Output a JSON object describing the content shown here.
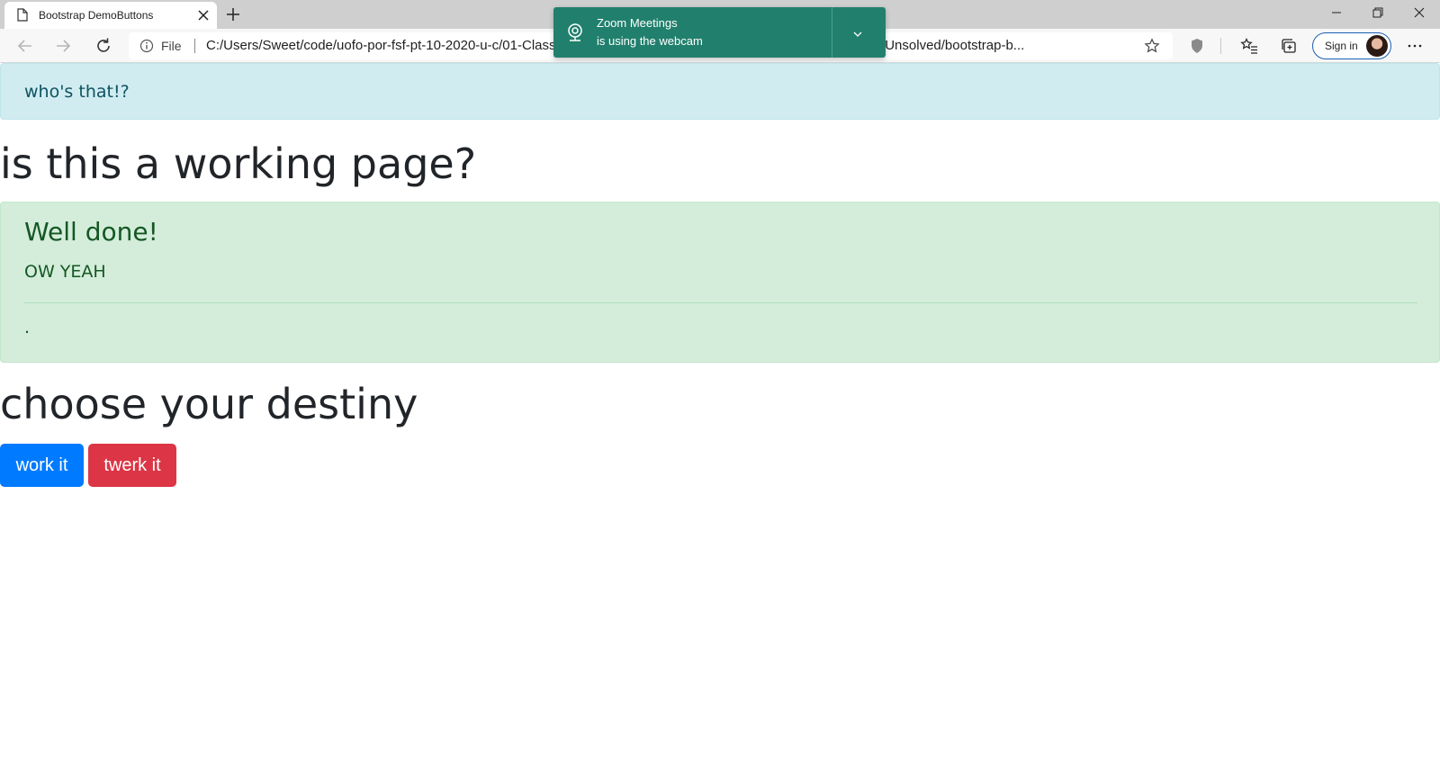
{
  "browser": {
    "tab_title": "Bootstrap DemoButtons",
    "address_scheme": "File",
    "url": "C:/Users/Sweet/code/uofo-por-fsf-pt-10-2020-u-c/01-Class-Content/04-Bootstrap/01-Activities/11-BootstrapDemo/Unsolved/bootstrap-b...",
    "sign_in_label": "Sign in"
  },
  "notification": {
    "title": "Zoom Meetings",
    "subtitle": "is using the webcam"
  },
  "page": {
    "info_alert": "who's that!?",
    "heading_1": "is this a working page?",
    "success_alert": {
      "heading": "Well done!",
      "body": "OW YEAH",
      "footer": "."
    },
    "heading_2": "choose your destiny",
    "buttons": {
      "primary": "work it",
      "danger": "twerk it"
    }
  },
  "colors": {
    "primary": "#007bff",
    "danger": "#dc3545",
    "info_bg": "#d1ecf1",
    "success_bg": "#d4edda",
    "toast_bg": "#21806d"
  }
}
